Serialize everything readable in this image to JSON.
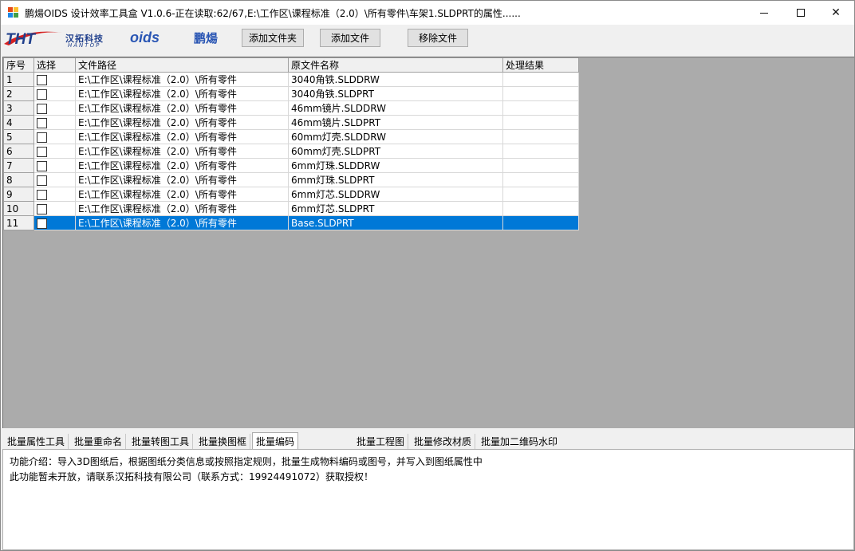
{
  "window": {
    "title": "鹏煬OIDS 设计效率工具盒 V1.0.6-正在读取:62/67,E:\\工作区\\课程标准（2.0）\\所有零件\\车架1.SLDPRT的属性......",
    "minimize_glyph": "",
    "close_glyph": "✕"
  },
  "logos": {
    "tht": "THT",
    "hantop_cn": "汉拓科技",
    "hantop_en": "HANTOP",
    "oids": "oids",
    "pengyang": "鹏煬"
  },
  "toolbar": {
    "add_folder": "添加文件夹",
    "add_file": "添加文件",
    "remove_file": "移除文件"
  },
  "grid": {
    "headers": [
      "序号",
      "选择",
      "文件路径",
      "原文件名称",
      "处理结果"
    ],
    "rows": [
      {
        "index": "1",
        "checked": false,
        "path": "E:\\工作区\\课程标准（2.0）\\所有零件",
        "name": "3040角铁.SLDDRW",
        "result": ""
      },
      {
        "index": "2",
        "checked": false,
        "path": "E:\\工作区\\课程标准（2.0）\\所有零件",
        "name": "3040角铁.SLDPRT",
        "result": ""
      },
      {
        "index": "3",
        "checked": false,
        "path": "E:\\工作区\\课程标准（2.0）\\所有零件",
        "name": "46mm镜片.SLDDRW",
        "result": ""
      },
      {
        "index": "4",
        "checked": false,
        "path": "E:\\工作区\\课程标准（2.0）\\所有零件",
        "name": "46mm镜片.SLDPRT",
        "result": ""
      },
      {
        "index": "5",
        "checked": false,
        "path": "E:\\工作区\\课程标准（2.0）\\所有零件",
        "name": "60mm灯壳.SLDDRW",
        "result": ""
      },
      {
        "index": "6",
        "checked": false,
        "path": "E:\\工作区\\课程标准（2.0）\\所有零件",
        "name": "60mm灯壳.SLDPRT",
        "result": ""
      },
      {
        "index": "7",
        "checked": false,
        "path": "E:\\工作区\\课程标准（2.0）\\所有零件",
        "name": "6mm灯珠.SLDDRW",
        "result": ""
      },
      {
        "index": "8",
        "checked": false,
        "path": "E:\\工作区\\课程标准（2.0）\\所有零件",
        "name": "6mm灯珠.SLDPRT",
        "result": ""
      },
      {
        "index": "9",
        "checked": false,
        "path": "E:\\工作区\\课程标准（2.0）\\所有零件",
        "name": "6mm灯芯.SLDDRW",
        "result": ""
      },
      {
        "index": "10",
        "checked": false,
        "path": "E:\\工作区\\课程标准（2.0）\\所有零件",
        "name": "6mm灯芯.SLDPRT",
        "result": ""
      },
      {
        "index": "11",
        "checked": false,
        "path": "E:\\工作区\\课程标准（2.0）\\所有零件",
        "name": "Base.SLDPRT",
        "result": "",
        "selected": true
      }
    ]
  },
  "tabs": [
    {
      "label": "批量属性工具"
    },
    {
      "label": "批量重命名"
    },
    {
      "label": "批量转图工具"
    },
    {
      "label": "批量换图框"
    },
    {
      "label": "批量编码",
      "active": true
    },
    {
      "label": "批量工程图"
    },
    {
      "label": "批量修改材质"
    },
    {
      "label": "批量加二维码水印"
    }
  ],
  "panel": {
    "line1": "功能介绍：导入3D图纸后，根据图纸分类信息或按照指定规则，批量生成物料编码或图号，并写入到图纸属性中",
    "line2": "此功能暂未开放，请联系汉拓科技有限公司（联系方式：19924491072）获取授权！"
  },
  "colors": {
    "selection": "#0078d7",
    "grid_background": "#ababab",
    "brand_red": "#d62020",
    "brand_blue": "#1f3f8c"
  }
}
